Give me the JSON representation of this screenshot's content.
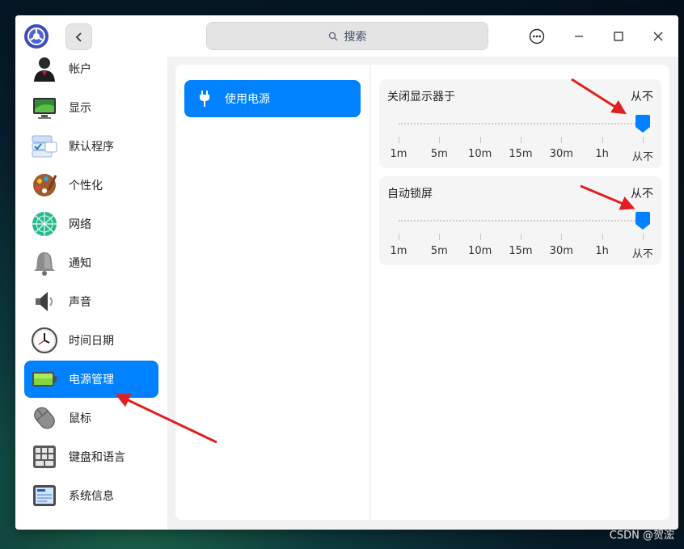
{
  "app": {
    "logo": "control-center-logo"
  },
  "titlebar": {
    "back_icon": "chevron-left-icon",
    "search_placeholder": "搜索",
    "menu_icon": "more-icon",
    "minimize_icon": "minimize-icon",
    "maximize_icon": "maximize-icon",
    "close_icon": "close-icon"
  },
  "sidebar": {
    "items": [
      {
        "label": "帐户",
        "icon": "account-icon"
      },
      {
        "label": "显示",
        "icon": "display-icon"
      },
      {
        "label": "默认程序",
        "icon": "default-apps-icon"
      },
      {
        "label": "个性化",
        "icon": "personalization-icon"
      },
      {
        "label": "网络",
        "icon": "network-icon"
      },
      {
        "label": "通知",
        "icon": "notification-bell-icon"
      },
      {
        "label": "声音",
        "icon": "speaker-icon"
      },
      {
        "label": "时间日期",
        "icon": "clock-icon"
      },
      {
        "label": "电源管理",
        "icon": "battery-icon",
        "active": true
      },
      {
        "label": "鼠标",
        "icon": "mouse-icon"
      },
      {
        "label": "键盘和语言",
        "icon": "keyboard-icon"
      },
      {
        "label": "系统信息",
        "icon": "system-info-icon"
      }
    ]
  },
  "power": {
    "submenu_label": "使用电源",
    "submenu_icon": "plug-icon",
    "screen_off": {
      "title": "关闭显示器于",
      "value": "从不",
      "level": 1.0
    },
    "lock_screen": {
      "title": "自动锁屏",
      "value": "从不",
      "level": 1.0
    },
    "ticks": [
      "1m",
      "5m",
      "10m",
      "15m",
      "30m",
      "1h",
      "从不"
    ]
  },
  "colors": {
    "accent": "#0081ff",
    "annotation_arrow": "#e02020"
  },
  "watermark": "CSDN @贺浤"
}
